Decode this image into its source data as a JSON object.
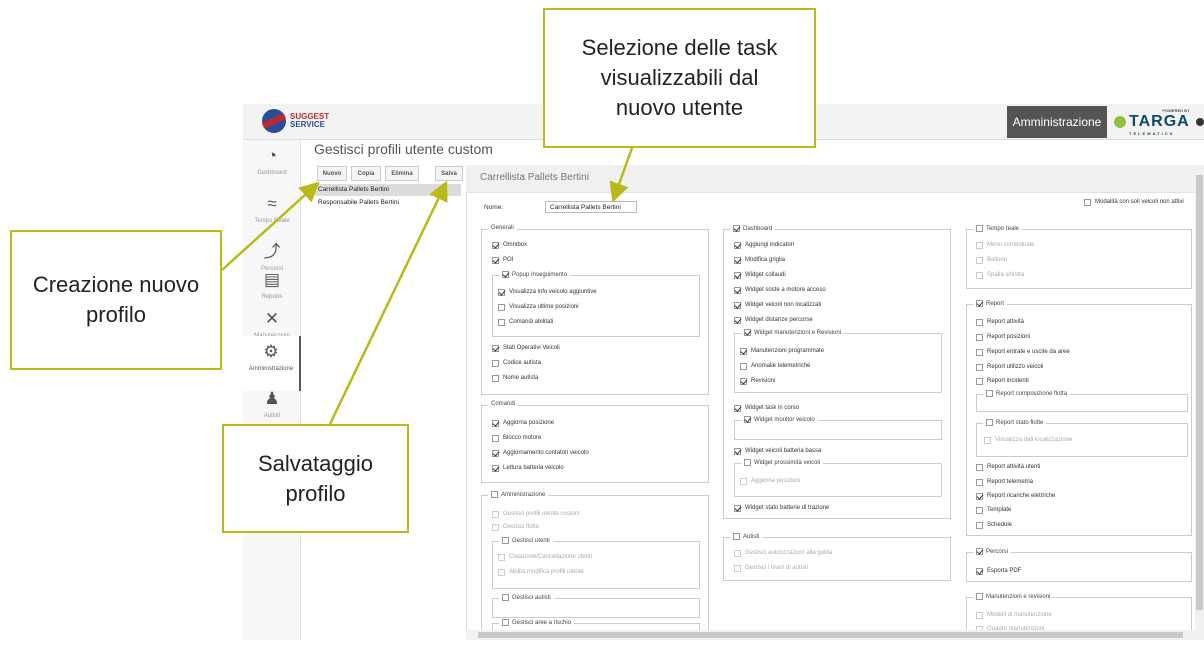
{
  "header": {
    "brand_line1": "SUGGEST",
    "brand_line2": "SERVICE",
    "admin_button": "Amministrazione",
    "partner_powered": "POWERED BY",
    "partner_name": "TARGA",
    "partner_sub": "TELEMATICS"
  },
  "sidebar": {
    "items": [
      {
        "label": "Dashboard",
        "icon": "dashboard-gauge-icon"
      },
      {
        "label": "Tempo Reale",
        "icon": "wifi-icon"
      },
      {
        "label": "Percorsi",
        "icon": "route-icon"
      },
      {
        "label": "Reports",
        "icon": "report-icon"
      },
      {
        "label": "Manutenzioni",
        "icon": "tools-icon"
      },
      {
        "label": "Amministrazione",
        "icon": "gears-icon",
        "active": true
      },
      {
        "label": "Autisti",
        "icon": "drivers-icon"
      }
    ]
  },
  "page": {
    "title": "Gestisci profili utente custom"
  },
  "toolbar": {
    "new": "Nuovo",
    "copy": "Copia",
    "delete": "Elimina",
    "save": "Salva"
  },
  "profiles": [
    "Carrellista Pallets Bertini",
    "Responsabile Pallets Bertini"
  ],
  "detail": {
    "heading": "Carrellista Pallets Bertini",
    "name_label": "Nome:",
    "name_value": "Carrellista Pallets Bertini",
    "only_inactive": "Modalità con soli veicoli non attivi",
    "generali": {
      "legend": "Generali",
      "omnibox": "Omnibox",
      "poi": "POI",
      "popup": "Popup Inseguimento",
      "info": "Visualizza info veicolo aggiuntive",
      "ultime": "Visualizza ultime posizioni",
      "comandi": "Comandi abilitati",
      "stati": "Stati Operativi Veicoli",
      "codice": "Codice autista",
      "nome": "Nome autista"
    },
    "comandi": {
      "legend": "Comandi",
      "aggiorna": "Aggiorna posizione",
      "blocco": "Blocco motore",
      "contatori": "Aggiornamento contatori veicolo",
      "batteria": "Lettura batteria veicolo"
    },
    "admin": {
      "legend": "Amministrazione",
      "profili": "Gestisci profili utente custom",
      "flotte": "Gestisci flotte",
      "utenti": "Gestisci utenti",
      "crea": "Creazione/Cancellazione utenti",
      "abilita": "Abilita modifica profili utente",
      "autisti": "Gestisci autisti",
      "aree": "Gestisci aree a rischio"
    },
    "dashboard": {
      "legend": "Dashboard",
      "indicatori": "Aggiungi indicatori",
      "griglia": "Modifica griglia",
      "collaudi": "Widget collaudi",
      "soste": "Widget soste a motore acceso",
      "nonloc": "Widget veicoli non localizzati",
      "distanze": "Widget distanze percorse",
      "manut": "Widget manutenzioni e Revisioni",
      "programmate": "Manutenzioni programmate",
      "anomalie": "Anomalie telemetriche",
      "revisioni": "Revisioni",
      "task": "Widget task in corso",
      "monitor": "Widget monitor veicolo",
      "batteria": "Widget veicoli batteria bassa",
      "prossimita": "Widget prossimità veicoli",
      "aggiorna": "Aggiorna posizioni",
      "trazione": "Widget stato batterie di trazione"
    },
    "autisti": {
      "legend": "Autisti",
      "autorizzazioni": "Gestisci autorizzazioni alla guida",
      "team": "Gestisci i team di autisti"
    },
    "tempo": {
      "legend": "Tempo reale",
      "menu": "Menu contestuale",
      "balloon": "Balloon",
      "spalla": "Spalla sinistra"
    },
    "report": {
      "legend": "Report",
      "attivita": "Report attività",
      "posizioni": "Report posizioni",
      "entrate": "Report entrate e uscite da aree",
      "utilizzo": "Report utilizzo veicoli",
      "incidenti": "Report incidenti",
      "composizione": "Report composizione flotta",
      "stato": "Report stato flotte",
      "localizzazione": "Visualizza dati localizzazione",
      "utenti": "Report attività utenti",
      "telemetria": "Report telemetria",
      "ricariche": "Report ricariche elettriche",
      "template": "Template",
      "schedule": "Schedule"
    },
    "percorsi": {
      "legend": "Percorsi",
      "pdf": "Esporta PDF"
    },
    "manutenzioni": {
      "legend": "Manutenzioni e revisioni",
      "modelli": "Modelli di manutenzione",
      "quadro": "Quadro manutenzioni"
    }
  },
  "callouts": {
    "task": "Selezione delle task visualizzabili dal nuovo utente",
    "creazione": "Creazione nuovo profilo",
    "salvataggio": "Salvataggio profilo"
  },
  "colors": {
    "callout_border": "#b9b917",
    "arrow": "#b9b917"
  }
}
